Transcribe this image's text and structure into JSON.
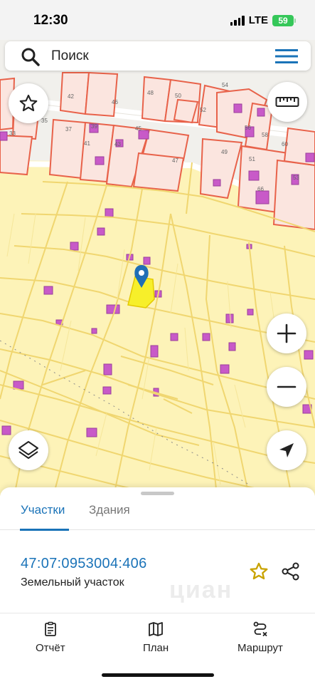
{
  "status_bar": {
    "time": "12:30",
    "network": "LTE",
    "battery": "59"
  },
  "search": {
    "placeholder": "Поиск"
  },
  "map": {
    "house_numbers": [
      "42",
      "46",
      "48",
      "50",
      "52",
      "54",
      "35",
      "37",
      "39",
      "41",
      "43",
      "45",
      "47",
      "33",
      "49",
      "51",
      "53",
      "56",
      "58",
      "60",
      "66"
    ],
    "controls": [
      "favorite-star",
      "ruler",
      "zoom-in",
      "zoom-out",
      "layers",
      "locate"
    ],
    "colors": {
      "parcel_fill": "#fdf3b8",
      "parcel_border": "#f0d670",
      "building_outline": "#e8624a",
      "building_fill": "#c85ac8",
      "selected_parcel": "#f7ef2a",
      "marker": "#1f6fb6"
    }
  },
  "sheet": {
    "tabs": [
      {
        "label": "Участки",
        "active": true
      },
      {
        "label": "Здания",
        "active": false
      }
    ],
    "parcel": {
      "cadastral_number": "47:07:0953004:406",
      "type": "Земельный участок"
    },
    "watermark": "циан"
  },
  "nav": {
    "items": [
      {
        "label": "Отчёт",
        "icon": "report-icon"
      },
      {
        "label": "План",
        "icon": "map-plan-icon"
      },
      {
        "label": "Маршрут",
        "icon": "route-icon"
      }
    ]
  }
}
